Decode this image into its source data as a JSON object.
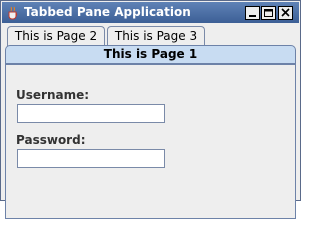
{
  "window": {
    "title": "Tabbed Pane Application"
  },
  "tabs": [
    {
      "label": "This is Page 2"
    },
    {
      "label": "This is Page 3"
    },
    {
      "label": "This is Page 1",
      "selected": true
    }
  ],
  "form": {
    "username_label": "Username:",
    "username_value": "",
    "password_label": "Password:",
    "password_value": ""
  },
  "colors": {
    "titlebar": "#4a6ea9",
    "selected_tab": "#c8dcf2",
    "border": "#6d82a8"
  }
}
